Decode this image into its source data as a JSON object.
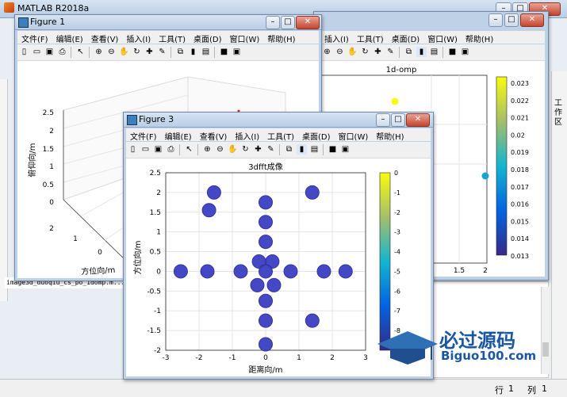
{
  "app": {
    "title": "MATLAB R2018a"
  },
  "main_window": {
    "side_label": "工作区",
    "file_entry": "image3d_duoqiu_cs_po_1domp.m...",
    "status": {
      "row_label": "行",
      "row_value": "1",
      "col_label": "列",
      "col_value": "1"
    }
  },
  "figure1": {
    "title": "Figure 1",
    "menu": [
      "文件(F)",
      "编辑(E)",
      "查看(V)",
      "插入(I)",
      "工具(T)",
      "桌面(D)",
      "窗口(W)",
      "帮助(H)"
    ],
    "z_ticks": [
      "0",
      "0.5",
      "1",
      "1.5",
      "2",
      "2.5"
    ],
    "z_label": "俯仰向/m",
    "y_ticks": [
      "2",
      "1",
      "0"
    ],
    "y_label": "方位向/m"
  },
  "figure2": {
    "menu_visible": [
      "插入(I)",
      "工具(T)",
      "桌面(D)",
      "窗口(W)",
      "帮助(H)"
    ],
    "title": "1d-omp",
    "x_ticks": [
      "1",
      "1.5",
      "2"
    ],
    "colorbar_ticks": [
      "0.023",
      "0.022",
      "0.021",
      "0.02",
      "0.019",
      "0.018",
      "0.017",
      "0.016",
      "0.015",
      "0.014",
      "0.013"
    ]
  },
  "figure3": {
    "title": "Figure 3",
    "menu": [
      "文件(F)",
      "编辑(E)",
      "查看(V)",
      "插入(I)",
      "工具(T)",
      "桌面(D)",
      "窗口(W)",
      "帮助(H)"
    ],
    "chart_title": "3dfft成像"
  },
  "watermark": {
    "main": "必过源码",
    "sub": "Biguo100.com"
  },
  "colors": {
    "parula_dark": "#352a87",
    "parula_mid": "#0f9ad6",
    "parula_yellow": "#f9fb0e",
    "titlebar": "#c7d8ec"
  },
  "chart_data": {
    "type": "scatter",
    "title": "3dfft成像",
    "xlabel": "距离向/m",
    "ylabel": "方位向/m",
    "xlim": [
      -3,
      3
    ],
    "ylim": [
      -2,
      2.5
    ],
    "x_ticks": [
      "-3",
      "-2",
      "-1",
      "0",
      "1",
      "2",
      "3"
    ],
    "y_ticks": [
      "2.5",
      "2",
      "1.5",
      "1",
      "0.5",
      "0",
      "-0.5",
      "-1",
      "-1.5",
      "-2"
    ],
    "colorbar": {
      "range": [
        -9,
        0
      ],
      "ticks": [
        "0",
        "-1",
        "-2",
        "-3",
        "-4",
        "-5",
        "-6",
        "-7",
        "-8"
      ]
    },
    "grid": true,
    "points": [
      {
        "x": -1.55,
        "y": 2.0
      },
      {
        "x": -1.7,
        "y": 1.55
      },
      {
        "x": 0.0,
        "y": 1.75
      },
      {
        "x": 0.0,
        "y": 1.25
      },
      {
        "x": 0.0,
        "y": 0.75
      },
      {
        "x": -0.2,
        "y": 0.25
      },
      {
        "x": 0.2,
        "y": 0.25
      },
      {
        "x": 1.4,
        "y": 2.0
      },
      {
        "x": -2.55,
        "y": 0.0
      },
      {
        "x": -1.75,
        "y": 0.0
      },
      {
        "x": -0.75,
        "y": 0.0
      },
      {
        "x": 0.0,
        "y": 0.0
      },
      {
        "x": 0.75,
        "y": 0.0
      },
      {
        "x": 1.75,
        "y": 0.0
      },
      {
        "x": 2.4,
        "y": 0.0
      },
      {
        "x": -0.25,
        "y": -0.35
      },
      {
        "x": 0.25,
        "y": -0.35
      },
      {
        "x": 0.0,
        "y": -0.75
      },
      {
        "x": 0.0,
        "y": -1.25
      },
      {
        "x": 0.0,
        "y": -1.85
      },
      {
        "x": 1.4,
        "y": -1.25
      }
    ]
  }
}
